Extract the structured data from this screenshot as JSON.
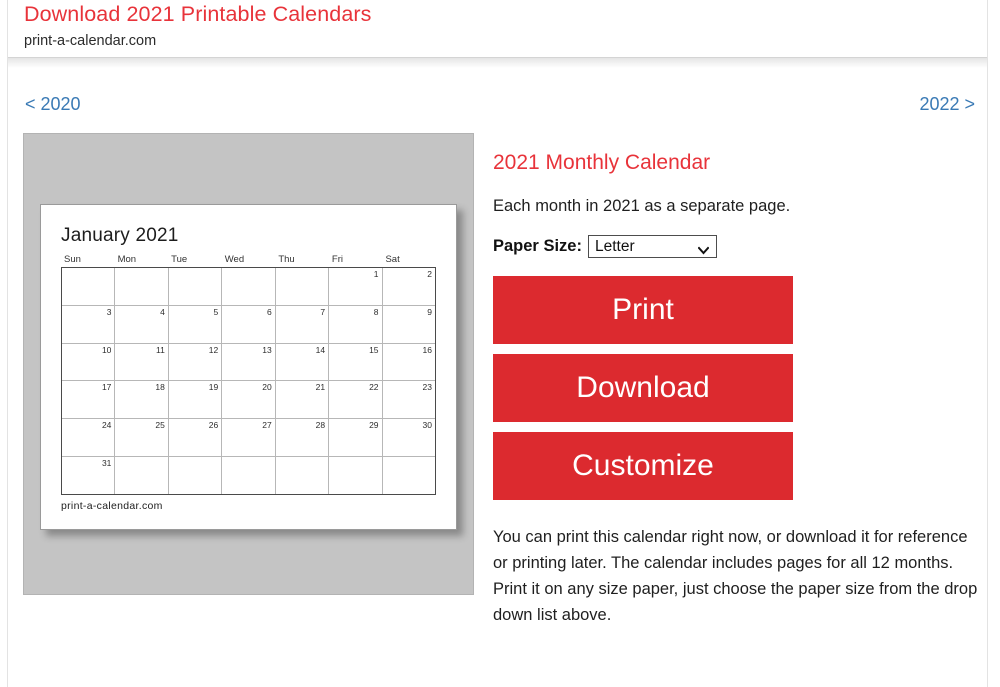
{
  "header": {
    "title": "Download 2021 Printable Calendars",
    "domain": "print-a-calendar.com"
  },
  "year_nav": {
    "prev_label": "< 2020",
    "next_label": "2022 >"
  },
  "preview": {
    "calendar": {
      "month_title": "January 2021",
      "footer": "print-a-calendar.com",
      "day_headers": [
        "Sun",
        "Mon",
        "Tue",
        "Wed",
        "Thu",
        "Fri",
        "Sat"
      ],
      "weeks": [
        [
          "",
          "",
          "",
          "",
          "",
          "1",
          "2"
        ],
        [
          "3",
          "4",
          "5",
          "6",
          "7",
          "8",
          "9"
        ],
        [
          "10",
          "11",
          "12",
          "13",
          "14",
          "15",
          "16"
        ],
        [
          "17",
          "18",
          "19",
          "20",
          "21",
          "22",
          "23"
        ],
        [
          "24",
          "25",
          "26",
          "27",
          "28",
          "29",
          "30"
        ],
        [
          "31",
          "",
          "",
          "",
          "",
          "",
          ""
        ]
      ]
    }
  },
  "content": {
    "product_title": "2021 Monthly Calendar",
    "subtitle": "Each month in 2021 as a separate page.",
    "paper_size_label": "Paper Size:",
    "paper_size_value": "Letter",
    "paper_size_options": [
      "Letter"
    ],
    "buttons": {
      "print": "Print",
      "download": "Download",
      "customize": "Customize"
    },
    "description": "You can print this calendar right now, or download it for reference or printing later. The calendar includes pages for all 12 months. Print it on any size paper, just choose the paper size from the drop down list above."
  },
  "colors": {
    "brand_red": "#e8333a",
    "button_red": "#dc2a2f",
    "link_blue": "#3a7ab5",
    "preview_gray": "#c4c4c4"
  }
}
